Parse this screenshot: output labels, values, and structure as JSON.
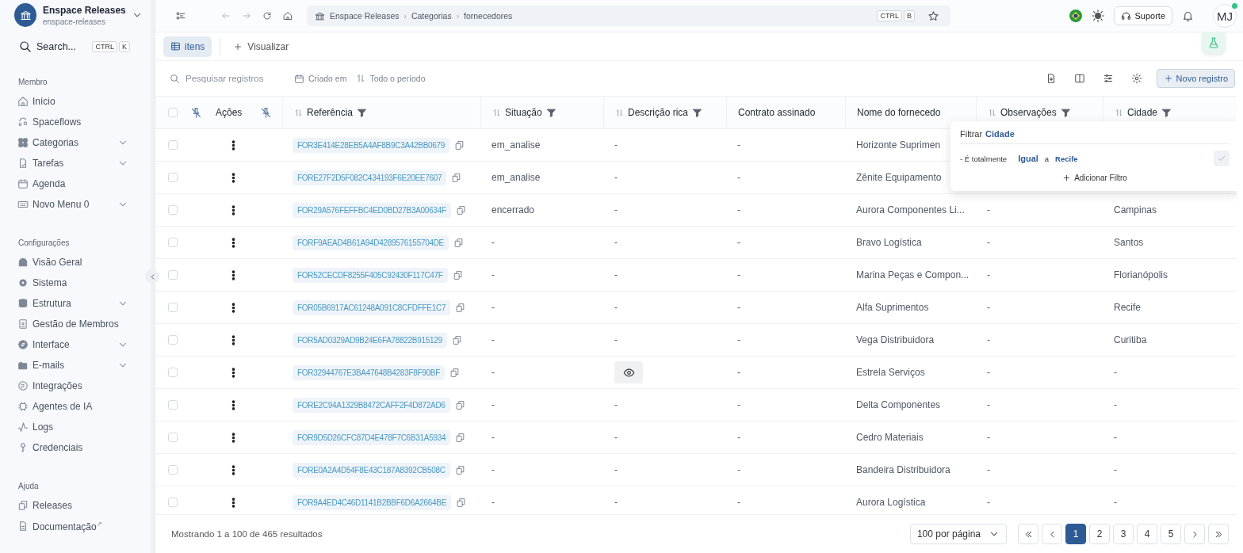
{
  "workspace": {
    "name": "Enspace Releases",
    "slug": "enspace-releases"
  },
  "search": {
    "label": "Search...",
    "keys": [
      "CTRL",
      "K"
    ]
  },
  "sidebar": {
    "sections": [
      {
        "title": "Membro",
        "items": [
          {
            "label": "Início",
            "expandable": false
          },
          {
            "label": "Spaceflows",
            "expandable": false
          },
          {
            "label": "Categorias",
            "expandable": true
          },
          {
            "label": "Tarefas",
            "expandable": true
          },
          {
            "label": "Agenda",
            "expandable": false
          },
          {
            "label": "Novo Menu 0",
            "expandable": true
          }
        ]
      },
      {
        "title": "Configurações",
        "items": [
          {
            "label": "Visão Geral",
            "expandable": false
          },
          {
            "label": "Sistema",
            "expandable": false
          },
          {
            "label": "Estrutura",
            "expandable": true
          },
          {
            "label": "Gestão de Membros",
            "expandable": false
          },
          {
            "label": "Interface",
            "expandable": true
          },
          {
            "label": "E-mails",
            "expandable": true
          },
          {
            "label": "Integrações",
            "expandable": false
          },
          {
            "label": "Agentes de IA",
            "expandable": false
          },
          {
            "label": "Logs",
            "expandable": false
          },
          {
            "label": "Credenciais",
            "expandable": false
          }
        ]
      },
      {
        "title": "Ajuda",
        "items": [
          {
            "label": "Releases",
            "expandable": false
          },
          {
            "label": "Documentação",
            "expandable": false,
            "external_mark": "↗"
          }
        ]
      }
    ]
  },
  "breadcrumb": [
    "Enspace Releases",
    "Categorias",
    "fornecedores"
  ],
  "breadcrumb_separator": "›",
  "bookmark_keys": [
    "CTRL",
    "B"
  ],
  "support": "Suporte",
  "avatar": {
    "initials": "MJ",
    "online": true
  },
  "views": [
    {
      "label": "itens",
      "selected": true
    }
  ],
  "add_view": "Visualizar",
  "toolbar": {
    "search_placeholder": "Pesquisar registros",
    "date_field": "Criado em",
    "period": "Todo o período",
    "new_record": "Novo registro"
  },
  "table": {
    "actions_label": "Ações",
    "all_selected": false,
    "columns": [
      {
        "label": "Referência",
        "sortable": true,
        "filter": true
      },
      {
        "label": "Situação",
        "sortable": true,
        "filter": true
      },
      {
        "label": "Descrição rica",
        "sortable": true,
        "filter": true
      },
      {
        "label": "Contrato assinado",
        "sortable": false,
        "filter": false
      },
      {
        "label": "Nome do fornecedo",
        "sortable": false,
        "filter": false
      },
      {
        "label": "Observações",
        "sortable": true,
        "filter": true
      },
      {
        "label": "Cidade",
        "sortable": true,
        "filter": true
      }
    ],
    "rows": [
      {
        "selected": false,
        "reference": "FOR3E414E28EB5A4AF8B9C3A42BB0679",
        "status": "em_analise",
        "description": {
          "kind": "text",
          "text": "-"
        },
        "contract": "-",
        "supplier": "Horizonte Suprimen"
      },
      {
        "selected": false,
        "reference": "FORE27F2D5F082C434193F6E20EE7607",
        "status": "em_analise",
        "description": {
          "kind": "text",
          "text": "-"
        },
        "contract": "-",
        "supplier": "Zênite Equipamento"
      },
      {
        "selected": false,
        "reference": "FOR29A576FEFFBC4ED0BD27B3A00634F",
        "status": "encerrado",
        "description": {
          "kind": "text",
          "text": "-"
        },
        "contract": "-",
        "supplier": "Aurora Componentes Li...",
        "notes": "-",
        "city": "Campinas"
      },
      {
        "selected": false,
        "reference": "FORF9AEAD4B61A94D4289576155704DE",
        "status": "-",
        "description": {
          "kind": "text",
          "text": "-"
        },
        "contract": "-",
        "supplier": "Bravo Logística",
        "notes": "-",
        "city": "Santos"
      },
      {
        "selected": false,
        "reference": "FOR52CECDF8255F405C92430F117C47F",
        "status": "-",
        "description": {
          "kind": "text",
          "text": "-"
        },
        "contract": "-",
        "supplier": "Marina Peças e Compon...",
        "notes": "-",
        "city": "Florianópolis"
      },
      {
        "selected": false,
        "reference": "FOR05B6917AC61248A091C8CFDFFE1C7",
        "status": "-",
        "description": {
          "kind": "text",
          "text": "-"
        },
        "contract": "-",
        "supplier": "Alfa Suprimentos",
        "notes": "-",
        "city": "Recife"
      },
      {
        "selected": false,
        "reference": "FOR5AD0329AD9B24E6FA78822B915129",
        "status": "-",
        "description": {
          "kind": "text",
          "text": "-"
        },
        "contract": "-",
        "supplier": "Vega Distribuidora",
        "notes": "-",
        "city": "Curitiba"
      },
      {
        "selected": false,
        "reference": "FOR32944767E3BA47648B4283F8F90BF",
        "status": "-",
        "description": {
          "kind": "preview"
        },
        "contract": "-",
        "supplier": "Estrela Serviços",
        "notes": "-",
        "city": "-"
      },
      {
        "selected": false,
        "reference": "FORE2C94A1329B8472CAFF2F4D872AD6",
        "status": "-",
        "description": {
          "kind": "text",
          "text": "-"
        },
        "contract": "-",
        "supplier": "Delta Componentes",
        "notes": "-",
        "city": "-"
      },
      {
        "selected": false,
        "reference": "FOR9D5D26CFC87D4E478F7C6B31A5934",
        "status": "-",
        "description": {
          "kind": "text",
          "text": "-"
        },
        "contract": "-",
        "supplier": "Cedro Materiais",
        "notes": "-",
        "city": "-"
      },
      {
        "selected": false,
        "reference": "FORE0A2A4D54F8E43C187A8392CB508C",
        "status": "-",
        "description": {
          "kind": "text",
          "text": "-"
        },
        "contract": "-",
        "supplier": "Bandeira Distribuidora",
        "notes": "-",
        "city": "-"
      },
      {
        "selected": false,
        "reference": "FOR9A4ED4C46D1141B2BBF6D6A2664BE",
        "status": "-",
        "description": {
          "kind": "text",
          "text": "-"
        },
        "contract": "-",
        "supplier": "Aurora Logística",
        "notes": "-",
        "city": "-"
      }
    ]
  },
  "filter_popup": {
    "title": "Filtrar",
    "field": "Cidade",
    "condition": {
      "prefix": "- É totalmente",
      "operator": "Igual",
      "joiner": "a",
      "value": "Recife"
    },
    "add": "Adicionar Filtro"
  },
  "footer": {
    "summary": "Mostrando 1 a 100 de 465 resultados",
    "per_page": "100 por página",
    "pages": [
      {
        "label": "1",
        "selected": true
      },
      {
        "label": "2",
        "selected": false
      },
      {
        "label": "3",
        "selected": false
      },
      {
        "label": "4",
        "selected": false
      },
      {
        "label": "5",
        "selected": false
      }
    ]
  }
}
